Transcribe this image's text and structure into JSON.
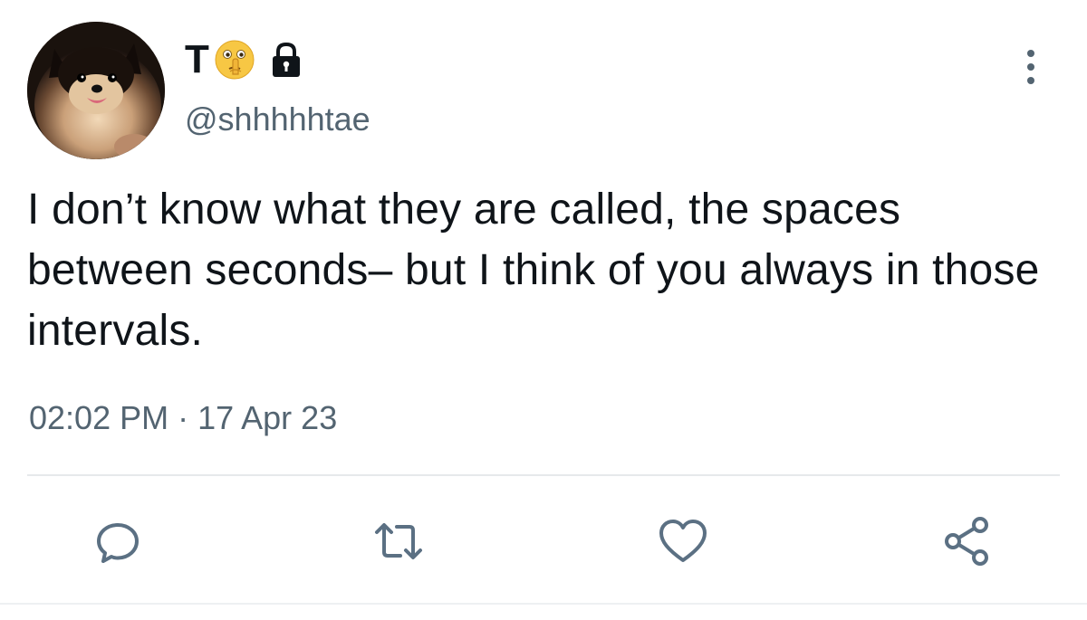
{
  "user": {
    "display_name": "T",
    "name_emoji": "shushing-face",
    "name_badge": "lock-icon",
    "handle": "@shhhhhtae"
  },
  "tweet": {
    "text": "I don’t know what they are called, the spaces between seconds– but I think of you always in those intervals.",
    "time": "02:02 PM",
    "separator": "·",
    "date": "17 Apr 23"
  },
  "actions": [
    {
      "name": "reply",
      "icon": "speech-bubble-icon"
    },
    {
      "name": "retweet",
      "icon": "retweet-arrows-icon"
    },
    {
      "name": "like",
      "icon": "heart-icon"
    },
    {
      "name": "share",
      "icon": "share-nodes-icon"
    }
  ],
  "colors": {
    "text": "#0f1419",
    "secondary": "#536471",
    "icon": "#5b7083",
    "divider": "#e6e9eb"
  }
}
